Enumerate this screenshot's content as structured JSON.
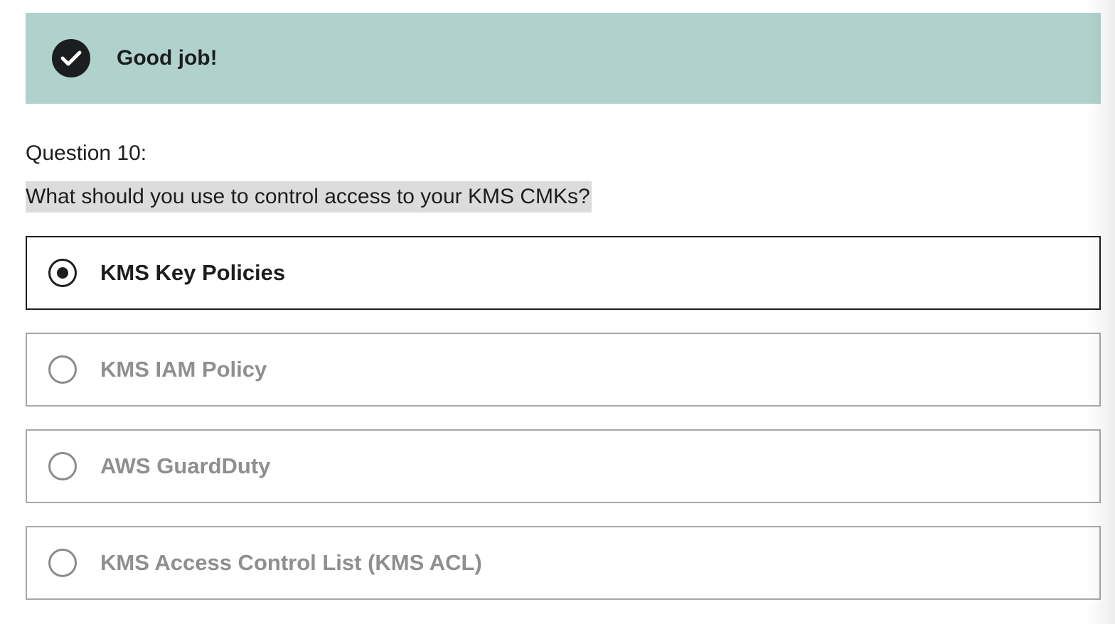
{
  "feedback": {
    "icon": "check-circle-icon",
    "text": "Good job!",
    "background_color": "#b1d2cc"
  },
  "question": {
    "number_label": "Question 10:",
    "text": "What should you use to control access to your KMS CMKs?"
  },
  "options": [
    {
      "label": "KMS Key Policies",
      "selected": true
    },
    {
      "label": "KMS IAM Policy",
      "selected": false
    },
    {
      "label": "AWS GuardDuty",
      "selected": false
    },
    {
      "label": "KMS Access Control List (KMS ACL)",
      "selected": false
    }
  ]
}
